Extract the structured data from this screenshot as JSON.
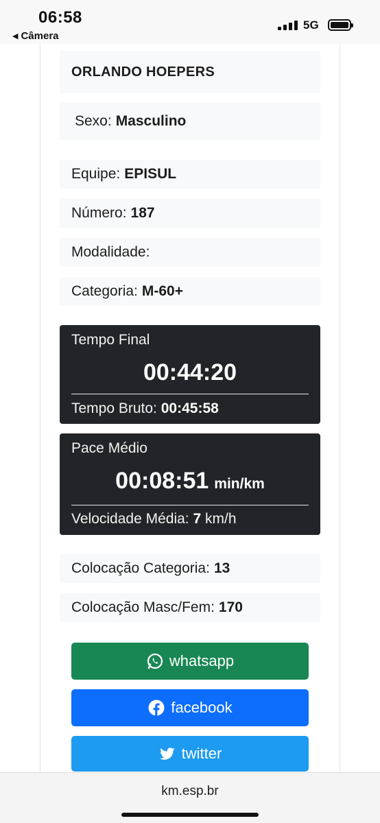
{
  "status_bar": {
    "time": "06:58",
    "back_app": "Câmera",
    "network": "5G",
    "icons": [
      "signal-icon",
      "battery-icon"
    ]
  },
  "athlete": {
    "name": "ORLANDO HOEPERS",
    "sexo_label": "Sexo:",
    "sexo_value": "Masculino",
    "equipe_label": "Equipe:",
    "equipe_value": "EPISUL",
    "numero_label": "Número:",
    "numero_value": "187",
    "modalidade_label": "Modalidade:",
    "modalidade_value": "",
    "categoria_label": "Categoria:",
    "categoria_value": "M-60+"
  },
  "time_card": {
    "label": "Tempo Final",
    "value": "00:44:20",
    "sub_label": "Tempo Bruto:",
    "sub_value": "00:45:58"
  },
  "pace_card": {
    "label": "Pace Médio",
    "value": "00:08:51",
    "unit": "min/km",
    "sub_label": "Velocidade Média:",
    "sub_value": "7",
    "sub_unit": "km/h"
  },
  "placement": {
    "categoria_label": "Colocação Categoria:",
    "categoria_value": "13",
    "masc_fem_label": "Colocação Masc/Fem:",
    "masc_fem_value": "170"
  },
  "share": {
    "whatsapp": "whatsapp",
    "facebook": "facebook",
    "twitter": "twitter",
    "colors": {
      "whatsapp": "#198754",
      "facebook": "#0d6efd",
      "twitter": "#1d9bf0"
    }
  },
  "browser": {
    "url": "km.esp.br"
  }
}
